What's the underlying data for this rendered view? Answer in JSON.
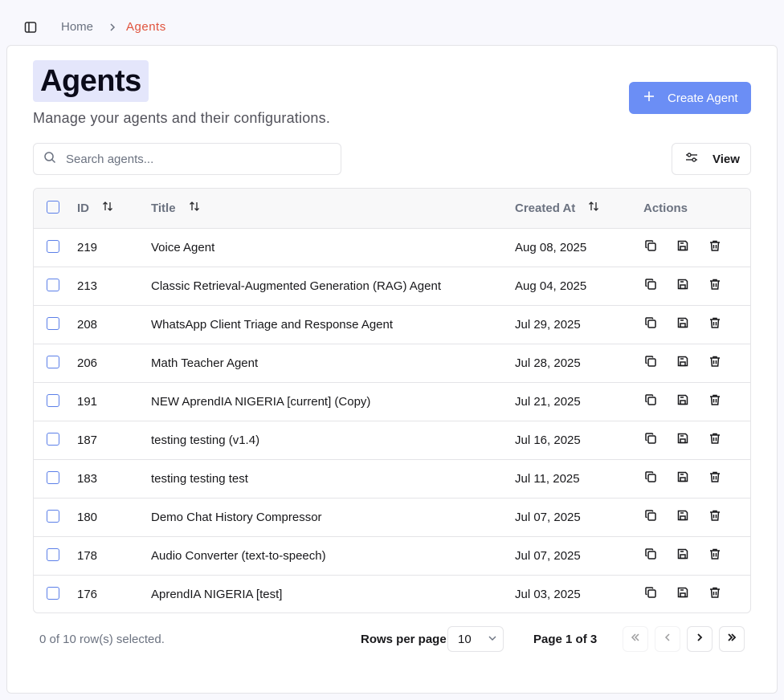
{
  "breadcrumb": {
    "home": "Home",
    "separator": "chevron-right-icon",
    "current": "Agents"
  },
  "header": {
    "title": "Agents",
    "subtitle": "Manage your agents and their configurations.",
    "create_label": "Create Agent"
  },
  "toolbar": {
    "search_placeholder": "Search agents...",
    "view_label": "View"
  },
  "table": {
    "columns": {
      "id": "ID",
      "title": "Title",
      "created": "Created At",
      "actions": "Actions"
    },
    "rows": [
      {
        "id": "219",
        "title": "Voice Agent",
        "created": "Aug 08, 2025"
      },
      {
        "id": "213",
        "title": "Classic Retrieval-Augmented Generation (RAG) Agent",
        "created": "Aug 04, 2025"
      },
      {
        "id": "208",
        "title": "WhatsApp Client Triage and Response Agent",
        "created": "Jul 29, 2025"
      },
      {
        "id": "206",
        "title": "Math Teacher Agent",
        "created": "Jul 28, 2025"
      },
      {
        "id": "191",
        "title": "NEW AprendIA NIGERIA [current] (Copy)",
        "created": "Jul 21, 2025"
      },
      {
        "id": "187",
        "title": "testing testing (v1.4)",
        "created": "Jul 16, 2025"
      },
      {
        "id": "183",
        "title": "testing testing test",
        "created": "Jul 11, 2025"
      },
      {
        "id": "180",
        "title": "Demo Chat History Compressor",
        "created": "Jul 07, 2025"
      },
      {
        "id": "178",
        "title": "Audio Converter (text-to-speech)",
        "created": "Jul 07, 2025"
      },
      {
        "id": "176",
        "title": "AprendIA NIGERIA [test]",
        "created": "Jul 03, 2025"
      }
    ],
    "action_icons": [
      "copy-icon",
      "save-icon",
      "trash-icon"
    ]
  },
  "footer": {
    "selection": "0 of 10 row(s) selected.",
    "rows_per_page_label": "Rows per page",
    "rows_per_page_value": "10",
    "page_info": "Page 1 of 3"
  },
  "colors": {
    "accent": "#6b8ef5",
    "breadcrumb_active": "#e0533d",
    "checkbox": "#5b7fe8"
  }
}
